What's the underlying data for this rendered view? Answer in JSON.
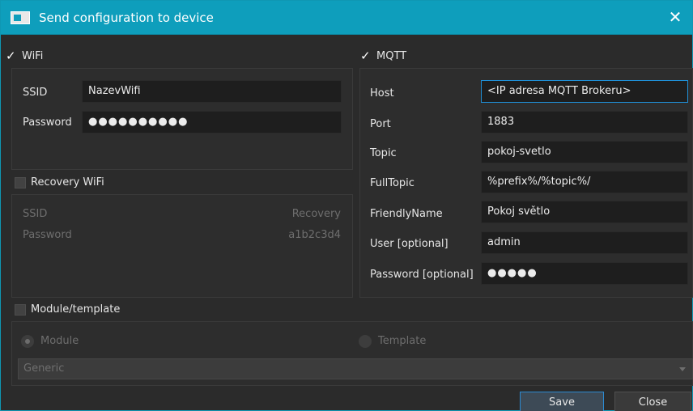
{
  "window": {
    "title": "Send configuration to device",
    "close_glyph": "✕"
  },
  "wifi": {
    "header": "WiFi",
    "ssid_label": "SSID",
    "ssid_value": "NazevWifi",
    "password_label": "Password",
    "password_value": "●●●●●●●●●●"
  },
  "recovery": {
    "header": "Recovery WiFi",
    "ssid_label": "SSID",
    "ssid_value": "Recovery",
    "password_label": "Password",
    "password_value": "a1b2c3d4"
  },
  "mqtt": {
    "header": "MQTT",
    "host_label": "Host",
    "host_value": "<IP adresa MQTT Brokeru>",
    "port_label": "Port",
    "port_value": "1883",
    "topic_label": "Topic",
    "topic_value": "pokoj-svetlo",
    "fulltopic_label": "FullTopic",
    "fulltopic_value": "%prefix%/%topic%/",
    "friendly_label": "FriendlyName",
    "friendly_value": "Pokoj světlo",
    "user_label": "User [optional]",
    "user_value": "admin",
    "password_label": "Password [optional]",
    "password_value": "●●●●●"
  },
  "module": {
    "header": "Module/template",
    "module_option": "Module",
    "template_option": "Template",
    "select_value": "Generic"
  },
  "buttons": {
    "save": "Save",
    "close": "Close"
  },
  "colors": {
    "titlebar": "#0e9ebc",
    "accent": "#1f8fd6",
    "background": "#2b2b2b"
  }
}
